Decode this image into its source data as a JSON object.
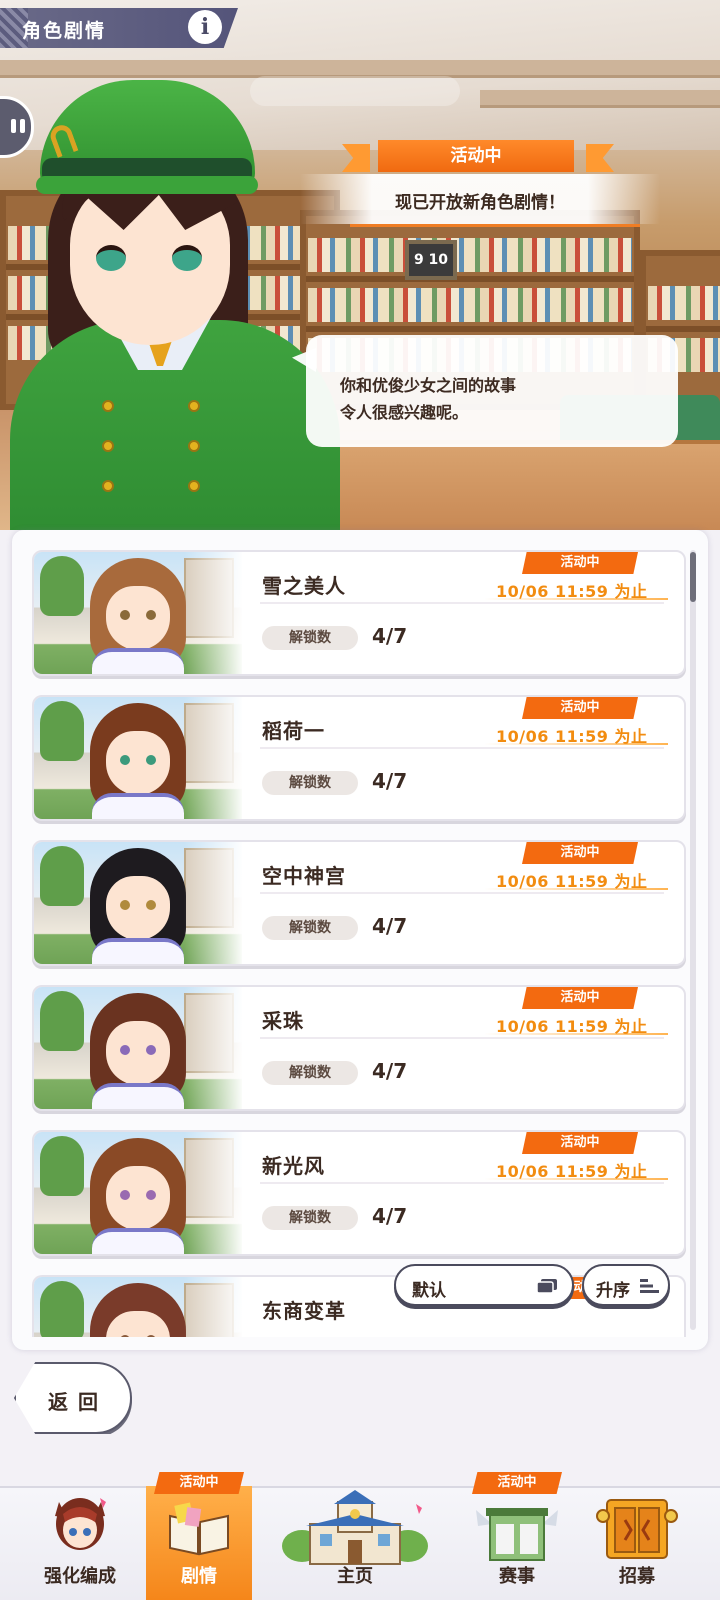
{
  "header": {
    "title": "角色剧情",
    "info_label": "i"
  },
  "event": {
    "badge": "活动中",
    "message": "现已开放新角色剧情！"
  },
  "dialogue": {
    "line1": "你和优俊少女之间的故事",
    "line2": "令人很感兴趣呢。"
  },
  "scene": {
    "clock_text": "9 10"
  },
  "stories": [
    {
      "name": "雪之美人",
      "tag": "活动中",
      "deadline": "10/06 11:59 为止",
      "unlock_label": "解锁数",
      "unlock_value": "4/7",
      "hair": "#a86a3c",
      "eye": "#8a6a3a"
    },
    {
      "name": "稻荷一",
      "tag": "活动中",
      "deadline": "10/06 11:59 为止",
      "unlock_label": "解锁数",
      "unlock_value": "4/7",
      "hair": "#7a3b1e",
      "eye": "#3c9a7c"
    },
    {
      "name": "空中神宫",
      "tag": "活动中",
      "deadline": "10/06 11:59 为止",
      "unlock_label": "解锁数",
      "unlock_value": "4/7",
      "hair": "#1e1b1f",
      "eye": "#b08a3c"
    },
    {
      "name": "采珠",
      "tag": "活动中",
      "deadline": "10/06 11:59 为止",
      "unlock_label": "解锁数",
      "unlock_value": "4/7",
      "hair": "#6a3320",
      "eye": "#8a6ab8"
    },
    {
      "name": "新光风",
      "tag": "活动中",
      "deadline": "10/06 11:59 为止",
      "unlock_label": "解锁数",
      "unlock_value": "4/7",
      "hair": "#8a4a26",
      "eye": "#9a6ab0"
    },
    {
      "name": "东商变革",
      "tag": "活动中",
      "deadline": "",
      "unlock_label": "",
      "unlock_value": "",
      "hair": "#7a3b2a",
      "eye": "#8a5a3a"
    }
  ],
  "controls": {
    "sort_label": "默认",
    "order_label": "升序",
    "back_label": "返回"
  },
  "nav": {
    "items": [
      {
        "label": "强化编成",
        "tag": ""
      },
      {
        "label": "剧情",
        "tag": "活动中"
      },
      {
        "label": "主页",
        "tag": ""
      },
      {
        "label": "赛事",
        "tag": "活动中"
      },
      {
        "label": "招募",
        "tag": ""
      }
    ]
  },
  "colors": {
    "accent": "#f36a10",
    "deadline": "#f28c10",
    "text": "#3b2a22"
  }
}
